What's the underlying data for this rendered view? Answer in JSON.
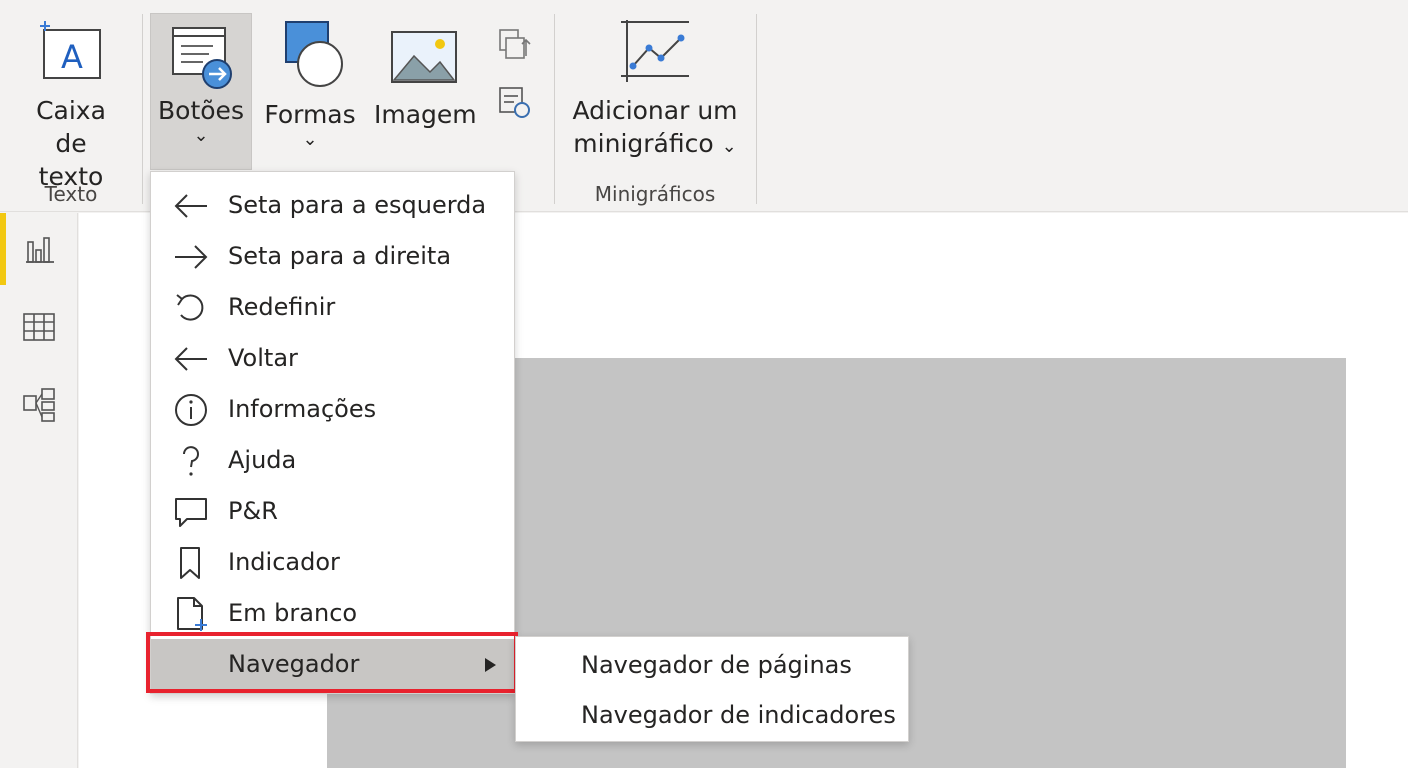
{
  "ribbon": {
    "text_box": {
      "line1": "Caixa de",
      "line2": "texto",
      "icon": "text-box-icon"
    },
    "buttons": {
      "label": "Botões",
      "icon": "buttons-icon"
    },
    "shapes": {
      "label": "Formas",
      "icon": "shapes-icon"
    },
    "image": {
      "label": "Imagem",
      "icon": "image-icon"
    },
    "sparkline": {
      "line1": "Adicionar um",
      "line2": "minigráfico",
      "icon": "sparkline-icon"
    },
    "groups": {
      "text": "Texto",
      "sparklines": "Minigráficos"
    },
    "chevron": "⌄"
  },
  "menu": {
    "items": [
      {
        "label": "Seta para a esquerda",
        "icon": "arrow-left-icon"
      },
      {
        "label": "Seta para a direita",
        "icon": "arrow-right-icon"
      },
      {
        "label": "Redefinir",
        "icon": "reset-icon"
      },
      {
        "label": "Voltar",
        "icon": "back-icon"
      },
      {
        "label": "Informações",
        "icon": "info-icon"
      },
      {
        "label": "Ajuda",
        "icon": "help-icon"
      },
      {
        "label": "P&R",
        "icon": "qna-icon"
      },
      {
        "label": "Indicador",
        "icon": "bookmark-icon"
      },
      {
        "label": "Em branco",
        "icon": "blank-icon"
      },
      {
        "label": "Navegador",
        "icon": "submenu-arrow-icon"
      }
    ]
  },
  "submenu": {
    "items": [
      {
        "label": "Navegador de páginas"
      },
      {
        "label": "Navegador de indicadores"
      }
    ]
  },
  "colors": {
    "accent": "#f2c811",
    "highlight_border": "#e8222e",
    "icon_blue": "#4a90d9"
  }
}
